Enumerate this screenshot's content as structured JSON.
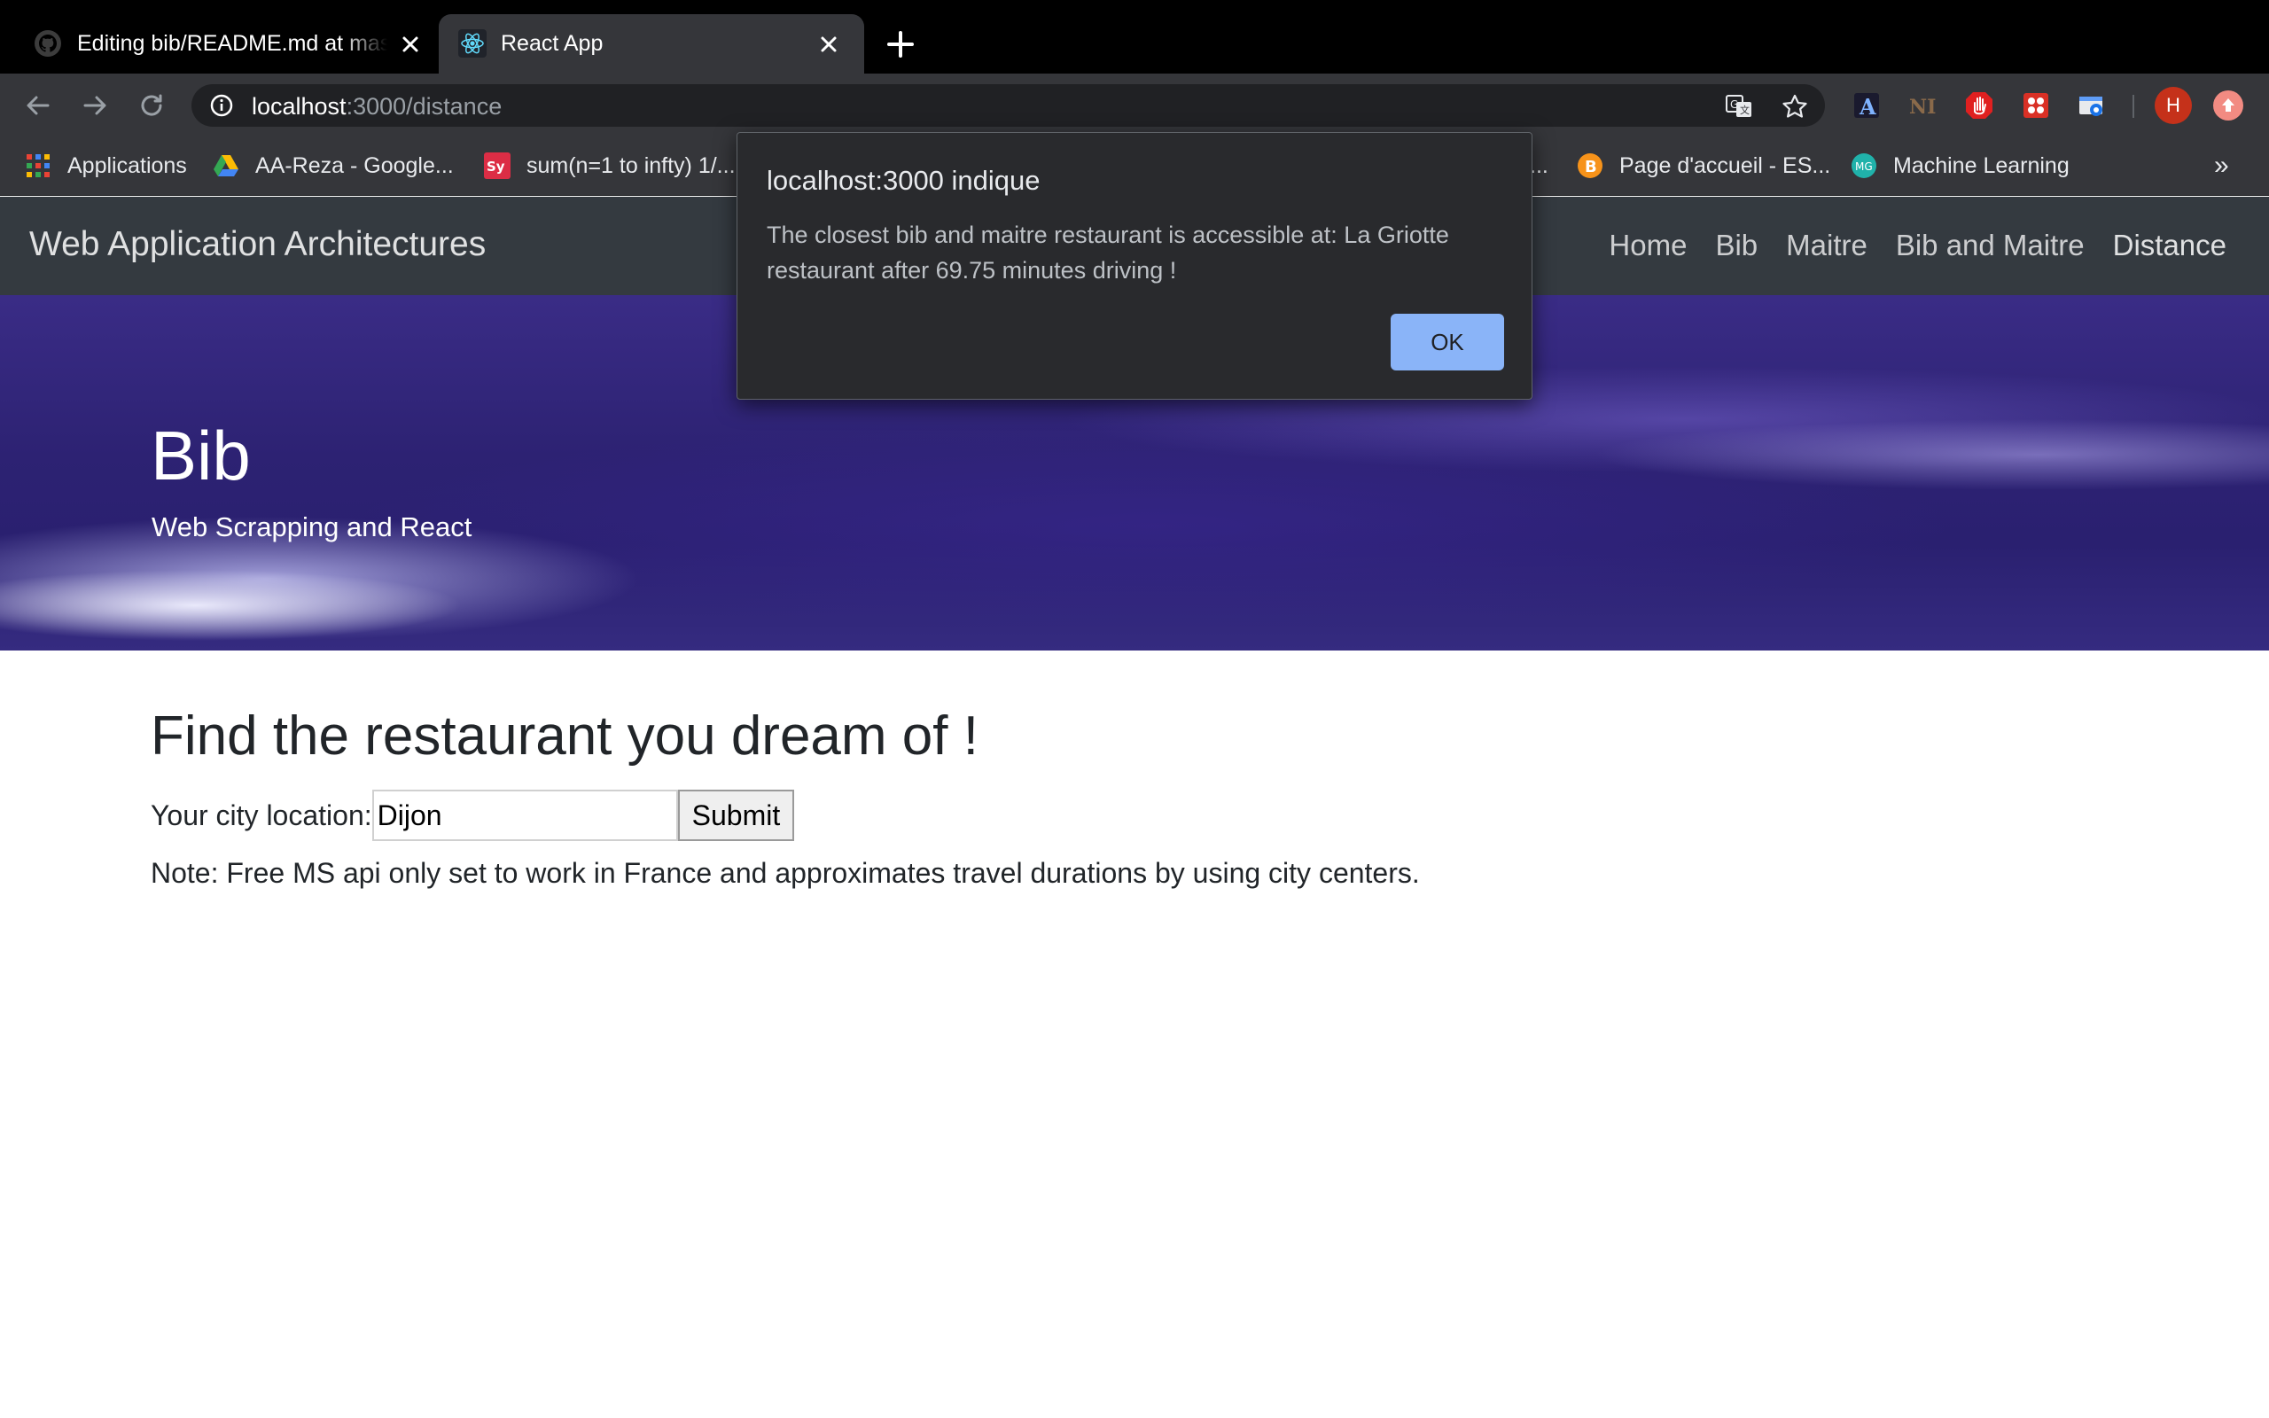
{
  "browser": {
    "tabs": [
      {
        "title": "Editing bib/README.md at master · bib",
        "favicon": "github-icon",
        "active": false
      },
      {
        "title": "React App",
        "favicon": "react-icon",
        "active": true
      }
    ],
    "url": {
      "host": "localhost",
      "path": ":3000/distance"
    },
    "bookmarks": [
      {
        "label": "Applications",
        "icon": "apps-grid-icon"
      },
      {
        "label": "AA-Reza - Google...",
        "icon": "google-drive-icon"
      },
      {
        "label": "sum(n=1 to infty) 1/...",
        "icon": "symbolab-icon"
      },
      {
        "label": "...",
        "icon": ""
      },
      {
        "label": "Page d'accueil - ES...",
        "icon": "bitcoin-icon"
      },
      {
        "label": "Machine Learning",
        "icon": "mg-icon"
      }
    ],
    "bookmarks_more": "»",
    "profile_initial": "H",
    "extensions": [
      "translate-icon",
      "star-icon",
      "a-extension-icon",
      "ni-extension-icon",
      "stop-hand-icon",
      "red-grid-icon",
      "screenshot-icon"
    ]
  },
  "app": {
    "brand": "Web Application Architectures",
    "nav": [
      "Home",
      "Bib",
      "Maitre",
      "Bib and Maitre",
      "Distance"
    ],
    "hero": {
      "title": "Bib",
      "subtitle": "Web Scrapping and React"
    },
    "main": {
      "heading": "Find the restaurant you dream of !",
      "city_label": "Your city location:",
      "city_value": "Dijon",
      "submit_label": "Submit",
      "note": "Note: Free MS api only set to work in France and approximates travel durations by using city centers."
    }
  },
  "dialog": {
    "title": "localhost:3000 indique",
    "message": "The closest bib and maitre restaurant is accessible at: La Griotte restaurant after 69.75 minutes driving !",
    "ok_label": "OK"
  },
  "colors": {
    "accent": "#8ab4f8",
    "navbar": "#343a40",
    "chrome": "#35363a"
  }
}
